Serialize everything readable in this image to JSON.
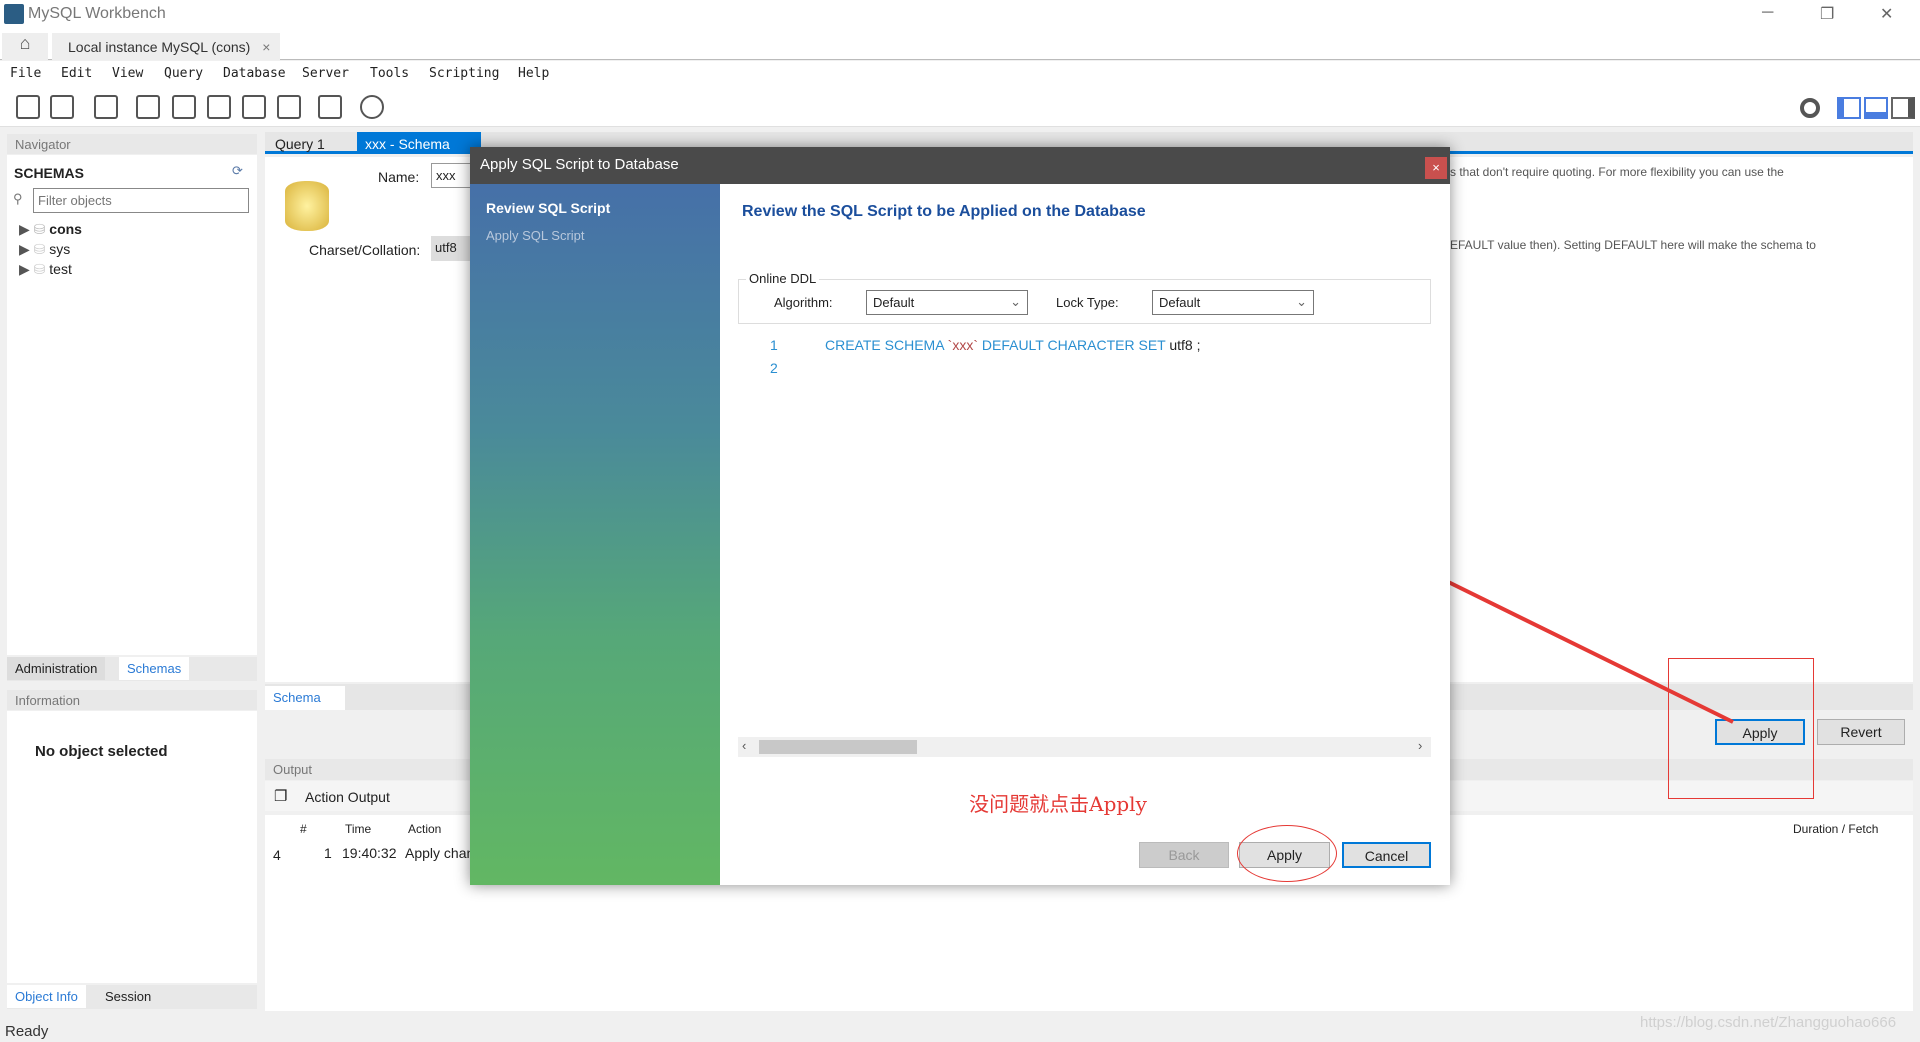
{
  "window": {
    "title": "MySQL Workbench",
    "minimize": "─",
    "restore": "❐",
    "close": "✕"
  },
  "tabs": {
    "home_icon": "home-icon",
    "connection_tab": "Local instance MySQL (cons)",
    "close": "×"
  },
  "menu": [
    "File",
    "Edit",
    "View",
    "Query",
    "Database",
    "Server",
    "Tools",
    "Scripting",
    "Help"
  ],
  "navigator": {
    "header": "Navigator",
    "schemas_label": "SCHEMAS",
    "filter_placeholder": "Filter objects",
    "schemas": [
      {
        "name": "cons",
        "bold": true
      },
      {
        "name": "sys"
      },
      {
        "name": "test"
      }
    ],
    "bottom_tabs": [
      "Administration",
      "Schemas"
    ]
  },
  "information": {
    "header": "Information",
    "message": "No object selected",
    "tabs": [
      "Object Info",
      "Session"
    ]
  },
  "editor": {
    "tabs": [
      "Query 1",
      "xxx - Schema"
    ],
    "name_label": "Name:",
    "name_value": "xxx",
    "charset_label": "Charset/Collation:",
    "charset_value": "utf8",
    "help_line1": "s that don't require quoting. For more flexibility you can use the",
    "help_line2": "EFAULT value then). Setting DEFAULT here will make the schema to",
    "bottom_tab": "Schema",
    "apply": "Apply",
    "revert": "Revert"
  },
  "output": {
    "header": "Output",
    "selector": "Action Output",
    "columns": [
      "#",
      "Time",
      "Action",
      "Duration / Fetch"
    ],
    "rows": [
      {
        "status": "4",
        "num": "1",
        "time": "19:40:32",
        "action": "Apply chan"
      }
    ]
  },
  "status": {
    "text": "Ready",
    "watermark": "https://blog.csdn.net/Zhangguohao666"
  },
  "dialog": {
    "title": "Apply SQL Script to Database",
    "close": "×",
    "steps": [
      "Review SQL Script",
      "Apply SQL Script"
    ],
    "heading": "Review the SQL Script to be Applied on the Database",
    "online_ddl": "Online DDL",
    "algorithm_label": "Algorithm:",
    "algorithm_value": "Default",
    "lock_label": "Lock Type:",
    "lock_value": "Default",
    "code": {
      "line_numbers": [
        "1",
        "2"
      ],
      "kw1": "CREATE SCHEMA",
      "ident": "`xxx`",
      "kw2": "DEFAULT CHARACTER SET",
      "rest": "utf8 ;"
    },
    "annotation": "没问题就点击Apply",
    "back": "Back",
    "apply": "Apply",
    "cancel": "Cancel"
  },
  "colors": {
    "accent": "#0078d7",
    "annotation": "#e53935",
    "dialog_title": "#4a4a4a",
    "keyword": "#2a8fd1"
  }
}
